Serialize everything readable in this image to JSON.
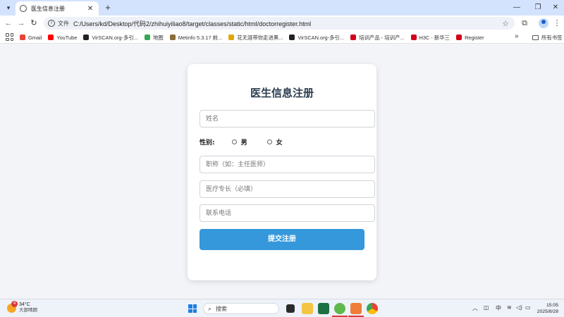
{
  "browser": {
    "tab": {
      "title": "医生信息注册"
    },
    "address": {
      "chip": "文件",
      "url": "C:/Users/kd/Desktop/代码2/zhihuiyiliao8/target/classes/static/html/doctorregister.html"
    },
    "bookmarks": [
      {
        "label": "Gmail",
        "color": "#ea4335"
      },
      {
        "label": "YouTube",
        "color": "#ff0000"
      },
      {
        "label": "VirSCAN.org-多引...",
        "color": "#222222"
      },
      {
        "label": "地图",
        "color": "#34a853"
      },
      {
        "label": "Metinfo 5.3.17 前...",
        "color": "#8a6d3b"
      },
      {
        "label": "花无涯带你走进黑...",
        "color": "#e0a800"
      },
      {
        "label": "VirSCAN.org-多引...",
        "color": "#222222"
      },
      {
        "label": "培训产品 - 培训产...",
        "color": "#d0021b"
      },
      {
        "label": "H3C - 新华三",
        "color": "#d0021b"
      },
      {
        "label": "Register",
        "color": "#d0021b"
      }
    ],
    "all_bookmarks_label": "所有书签"
  },
  "form": {
    "title": "医生信息注册",
    "name_placeholder": "姓名",
    "gender_label": "性别:",
    "gender_options": [
      "男",
      "女"
    ],
    "title_placeholder": "职称（如：主任医师）",
    "specialty_placeholder": "医疗专长（必填）",
    "phone_placeholder": "联系电话",
    "submit_label": "提交注册"
  },
  "taskbar": {
    "weather_temp": "34°C",
    "weather_desc": "大部晴朗",
    "weather_badge": "4",
    "search_label": "搜索",
    "ime": "中",
    "time": "15:05",
    "date": "2025/8/28"
  },
  "colors": {
    "accent": "#3498db",
    "title": "#2c3e50"
  }
}
